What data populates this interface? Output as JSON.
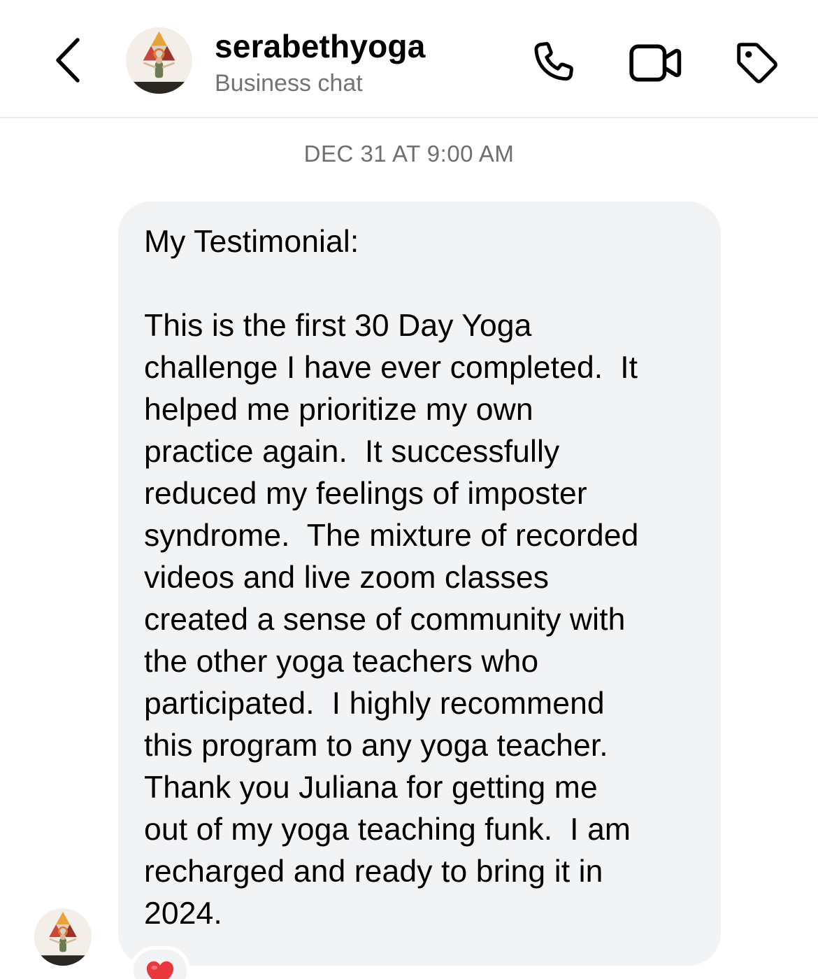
{
  "header": {
    "back_icon": "chevron-left-icon",
    "username": "serabethyoga",
    "subtitle": "Business chat",
    "avatar_icon": "yoga-triangle-logo-avatar",
    "actions": {
      "call_icon": "phone-icon",
      "video_icon": "video-camera-icon",
      "label_icon": "tag-icon"
    }
  },
  "conversation": {
    "timestamp": "DEC 31 AT 9:00 AM",
    "message": {
      "heading": "My Testimonial:",
      "body_lines": [
        "This is the first 30 Day Yoga",
        "challenge I have ever completed.  It",
        "helped me prioritize my own",
        "practice again.  It successfully",
        "reduced my feelings of imposter",
        "syndrome.  The mixture of recorded",
        "videos and live zoom classes",
        "created a sense of community with",
        "the other yoga teachers who",
        "participated.  I highly recommend",
        "this program to any yoga teacher.",
        "Thank you Juliana for getting me",
        "out of my yoga teaching funk.  I am",
        "recharged and ready to bring it in",
        "2024."
      ],
      "reaction": "❤️"
    }
  },
  "colors": {
    "bubble_background": "#f2f3f5",
    "subtitle_gray": "#737373",
    "timestamp_gray": "#6f6f6f",
    "divider": "#ececec",
    "heart_red": "#e8383d"
  }
}
